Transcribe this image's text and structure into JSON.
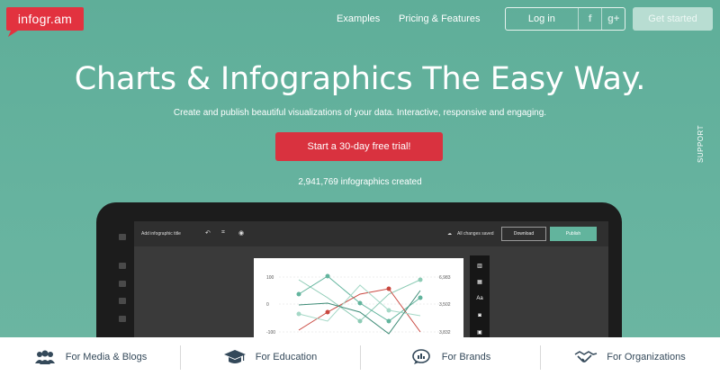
{
  "nav": {
    "logo": "infogr.am",
    "links": [
      "Examples",
      "Pricing & Features"
    ],
    "login": "Log in",
    "social": [
      "f",
      "g+"
    ],
    "get_started": "Get started"
  },
  "hero": {
    "headline": "Charts & Infographics The Easy Way.",
    "subtitle": "Create and publish beautiful visualizations of your data. Interactive, responsive and engaging.",
    "cta": "Start a 30-day free trial!",
    "counter": "2,941,769  infographics created",
    "support": "SUPPORT"
  },
  "editor": {
    "title_placeholder": "Add infographic title",
    "saved": "All changes saved",
    "download": "Download",
    "publish": "Publish",
    "y_labels": [
      "100",
      "0",
      "-100"
    ],
    "y_labels_right": [
      "6,983",
      "3,502",
      "3,832"
    ],
    "tools": [
      "▥",
      "▦",
      "Aa",
      "◙",
      "▣"
    ]
  },
  "categories": [
    {
      "label": "For Media & Blogs",
      "icon": "people-icon"
    },
    {
      "label": "For Education",
      "icon": "graduation-cap-icon"
    },
    {
      "label": "For Brands",
      "icon": "speech-bubble-icon"
    },
    {
      "label": "For Organizations",
      "icon": "handshake-icon"
    }
  ],
  "colors": {
    "hero_bg": "#64b19c",
    "brand_red": "#e2323f",
    "cta_red": "#d9323f",
    "publish_green": "#62b49d",
    "category_text": "#34495a"
  }
}
